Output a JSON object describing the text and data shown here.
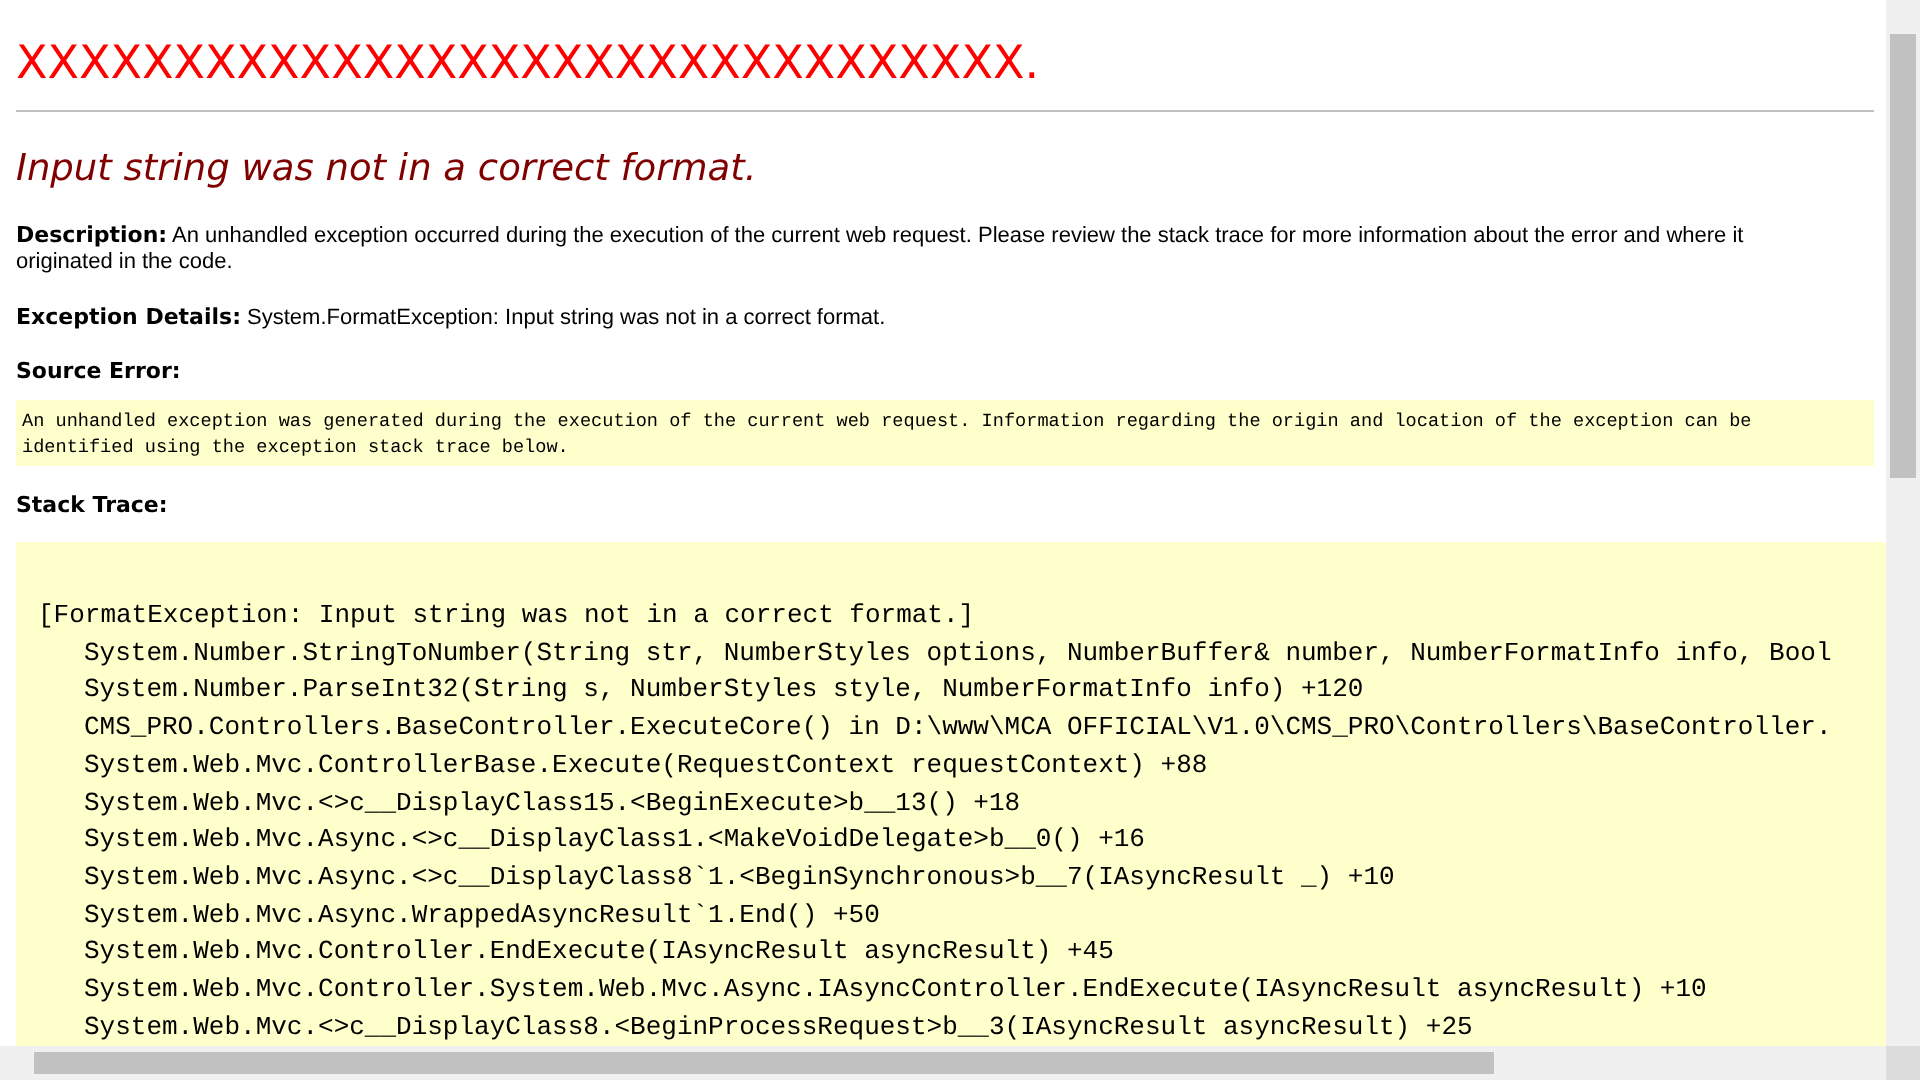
{
  "title": "XXXXXXXXXXXXXXXXXXXXXXXXXXXXXXXX.",
  "error_heading": "Input string was not in a correct format.",
  "description": {
    "label": "Description:",
    "text": "An unhandled exception occurred during the execution of the current web request. Please review the stack trace for more information about the error and where it originated in the code."
  },
  "exception_details": {
    "label": "Exception Details:",
    "text": "System.FormatException: Input string was not in a correct format."
  },
  "source_error": {
    "label": "Source Error:",
    "message": "An unhandled exception was generated during the execution of the current web request. Information regarding the origin and location of the exception can be identified using the exception stack trace below."
  },
  "stack_trace": {
    "label": "Stack Trace:",
    "exception": "[FormatException: Input string was not in a correct format.]",
    "frames": [
      "System.Number.StringToNumber(String str, NumberStyles options, NumberBuffer& number, NumberFormatInfo info, Bool",
      "System.Number.ParseInt32(String s, NumberStyles style, NumberFormatInfo info) +120",
      "CMS_PRO.Controllers.BaseController.ExecuteCore() in D:\\www\\MCA OFFICIAL\\V1.0\\CMS_PRO\\Controllers\\BaseController.",
      "System.Web.Mvc.ControllerBase.Execute(RequestContext requestContext) +88",
      "System.Web.Mvc.<>c__DisplayClass15.<BeginExecute>b__13() +18",
      "System.Web.Mvc.Async.<>c__DisplayClass1.<MakeVoidDelegate>b__0() +16",
      "System.Web.Mvc.Async.<>c__DisplayClass8`1.<BeginSynchronous>b__7(IAsyncResult _) +10",
      "System.Web.Mvc.Async.WrappedAsyncResult`1.End() +50",
      "System.Web.Mvc.Controller.EndExecute(IAsyncResult asyncResult) +45",
      "System.Web.Mvc.Controller.System.Web.Mvc.Async.IAsyncController.EndExecute(IAsyncResult asyncResult) +10",
      "System.Web.Mvc.<>c__DisplayClass8.<BeginProcessRequest>b__3(IAsyncResult asyncResult) +25"
    ]
  }
}
